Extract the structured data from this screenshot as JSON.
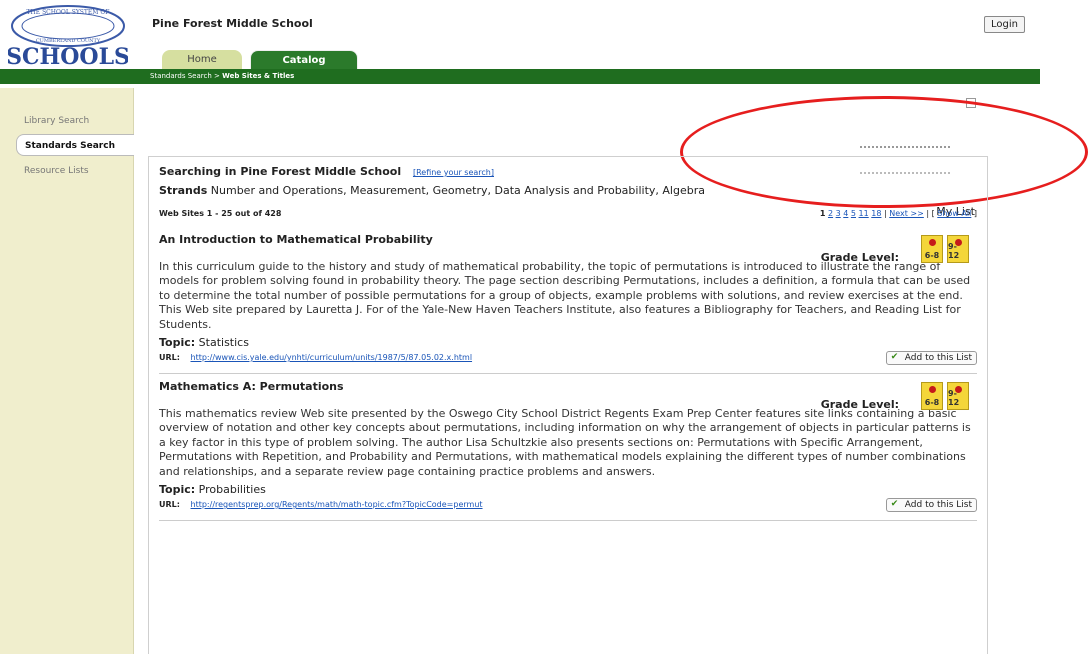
{
  "header": {
    "school_name": "Pine Forest Middle School",
    "login_label": "Login",
    "logo_top_text": "THE SCHOOL SYSTEM OF",
    "logo_mid_text": "CUMBERLAND COUNTY",
    "logo_main_text": "SCHOOLS"
  },
  "tabs": [
    {
      "label": "Home"
    },
    {
      "label": "Catalog"
    }
  ],
  "breadcrumb": {
    "first": "Standards Search",
    "separator": ">",
    "current": "Web Sites & Titles"
  },
  "sidebar": {
    "items": [
      {
        "label": "Library Search"
      },
      {
        "label": "Standards Search"
      },
      {
        "label": "Resource Lists"
      }
    ]
  },
  "search": {
    "heading": "Searching in Pine Forest Middle School",
    "refine_link": "[Refine your search]",
    "strands_label": "Strands",
    "strands_text": "Number and Operations, Measurement, Geometry, Data Analysis and Probability, Algebra",
    "my_list": "My List",
    "results_count": "Web Sites 1 - 25 out of 428"
  },
  "pager": {
    "pages": [
      "1",
      "2",
      "3",
      "4",
      "5",
      "11",
      "18"
    ],
    "next": "Next >>",
    "show_all": "Show All"
  },
  "results": [
    {
      "title": "An Introduction to Mathematical Probability",
      "grade_label": "Grade Level:",
      "grades": [
        "6-8",
        "9-12"
      ],
      "description": "In this curriculum guide to the history and study of mathematical probability, the topic of permutations is introduced to illustrate the range of models for problem solving found in probability theory. The page section describing Permutations, includes a definition, a formula that can be used to determine the total number of possible permutations for a group of objects, example problems with solutions, and review exercises at the end. This Web site prepared by Lauretta J. For of the Yale-New Haven Teachers Institute, also features a Bibliography for Teachers, and Reading List for Students.",
      "topic_label": "Topic:",
      "topic": "Statistics",
      "url_label": "URL:",
      "url": "http://www.cis.yale.edu/ynhti/curriculum/units/1987/5/87.05.02.x.html",
      "add_label": "Add to this List"
    },
    {
      "title": "Mathematics A: Permutations",
      "grade_label": "Grade Level:",
      "grades": [
        "6-8",
        "9-12"
      ],
      "description": "This mathematics review Web site presented by the Oswego City School District Regents Exam Prep Center features site links containing a basic overview of notation and other key concepts about permutations, including information on why the arrangement of objects in particular patterns is a key factor in this type of problem solving. The author Lisa Schultzkie also presents sections on: Permutations with Specific Arrangement, Permutations with Repetition, and Probability and Permutations, with mathematical models explaining the different types of number combinations and relationships, and a separate review page containing practice problems and answers.",
      "topic_label": "Topic:",
      "topic": "Probabilities",
      "url_label": "URL:",
      "url": "http://regentsprep.org/Regents/math/math-topic.cfm?TopicCode=permut",
      "add_label": "Add to this List"
    }
  ],
  "colors": {
    "green_bar": "#1f6d1f",
    "sidebar_bg": "#f0eecd",
    "annotation": "#e61e1e",
    "link": "#1a55b8"
  }
}
